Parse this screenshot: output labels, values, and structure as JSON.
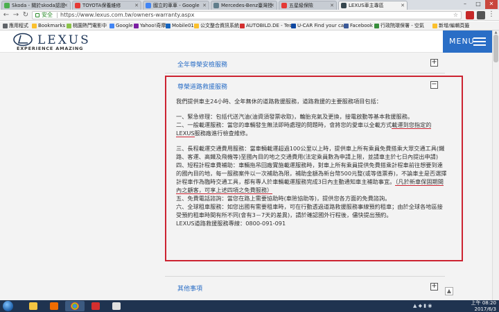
{
  "browser": {
    "tabs": [
      {
        "title": "Skoda - 關於skoda認證",
        "color": "#4caf50"
      },
      {
        "title": "TOYOTA保養維修",
        "color": "#e53935"
      },
      {
        "title": "國立的車車 - Google",
        "color": "#4285f4"
      },
      {
        "title": "Mercedes-Benz臺灣授",
        "color": "#607d8b"
      },
      {
        "title": "五星級保險",
        "color": "#e53935"
      },
      {
        "title": "LEXUS車主專區",
        "color": "#37474f"
      }
    ],
    "window_controls": [
      "–",
      "□",
      "✕"
    ],
    "address": {
      "secure_label": "安全",
      "url": "https://www.lexus.com.tw/owners-warranty.aspx"
    },
    "bookmarks": [
      {
        "label": "應用程式",
        "color": "#5f6368"
      },
      {
        "label": "Bookmarks",
        "color": "#fbc02d"
      },
      {
        "label": "桃園熱門電影中",
        "color": "#8bc34a"
      },
      {
        "label": "Google",
        "color": "#4285f4"
      },
      {
        "label": "Yahoo!奇摩",
        "color": "#7b1fa2"
      },
      {
        "label": "Mobile01",
        "color": "#1565c0"
      },
      {
        "label": "公文整合資訊系統",
        "color": "#fbc02d"
      },
      {
        "label": "AUTOBILD.DE - Test",
        "color": "#d32f2f"
      },
      {
        "label": "U-CAR Find your car.",
        "color": "#0d47a1"
      },
      {
        "label": "Facebook",
        "color": "#3b5998"
      },
      {
        "label": "行政院環保署 - 空氣",
        "color": "#388e3c"
      },
      {
        "label": "新增/編輯頁籤",
        "color": "#fbc02d"
      }
    ]
  },
  "site": {
    "logo_text": "LEXUS",
    "tagline": "EXPERIENCE AMAZING",
    "menu_label": "MENU"
  },
  "accordion": {
    "item1_title": "全年尊榮安檢服務",
    "item1_icon": "+",
    "item2_title": "尊榮道路救援服務",
    "item2_icon": "−",
    "item3_title": "其他事項",
    "item3_icon": "+"
  },
  "roadside": {
    "intro": "我們提供車主24小時、全年無休的道路救援服務，道路救援的主要服務項目包括：",
    "p1": "一、緊急修理：包括代送汽油(油資須發票收取)，輪胎充氣及更換，接電啟動等基本救援服務。",
    "p2a": "二、一般載運服務：當您的車輛發生無法即時處理的問題時，會將您的愛車以全載方式",
    "p2b": "載運到您指定的LEXUS",
    "p2c": "服務廠進行檢查維修。",
    "p3": "三、長程載運交通費用服務：當車輛載運超過100公里以上時，提供車上所有乘員免費搭乘大眾交通工具(鐵路、客運、高鐵及飛機等)至國內目的地之交通費用(法定乘員數為申請上限，並請車主於七日內提出申請)",
    "p4a": "四、短程計程車費補助：車輛拖吊回廠實施載運服務時，對車上所有乘員提供免費搭乘計程車前往想要到達的國內目的地，每一服務案件以一次補助為限，補助金額為新台幣500元整(或等值票券)，不論車主是否選擇計程車作為臨時交通工具，都有專人於車輛載運服務完成3日內主動通知車主補助事宜。",
    "p4b": "（凡於新車保固期間內之顧客，可享上述四項之免費服務）",
    "p5": "五、免費電話諮詢：當您在路上需要協助時(車險協助等)，提供您各方面的免費諮詢。",
    "p6": "六、全球租車服務：如您出國有需要租車時，可在行動透過道路救援服務事線預約租車；由於全球各地區接受預約租車時間有所不同(會有3－7天的差異)，請於確認國外行程後，儘快提出預約。",
    "hotline": "LEXUS道路救援服務專線：0800-091-091"
  },
  "taskbar": {
    "apps": [
      {
        "name": "explorer",
        "color": "#f4c542"
      },
      {
        "name": "media",
        "color": "#ef6c00"
      },
      {
        "name": "chrome",
        "color": "#34a853"
      },
      {
        "name": "acrobat",
        "color": "#d32f2f"
      },
      {
        "name": "document",
        "color": "#e0e0e0"
      }
    ],
    "time": "上午 08:20",
    "date": "2017/6/3"
  }
}
